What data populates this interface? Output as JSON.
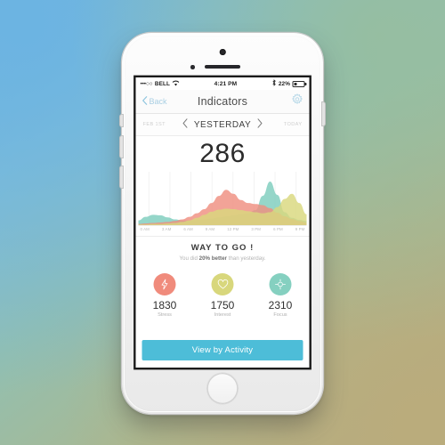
{
  "background": {
    "gradient_from": "#6FB4E0",
    "gradient_mid": "#93BFAF",
    "gradient_to": "#B7A97E"
  },
  "status_bar": {
    "signal_dots": "•••○○",
    "carrier": "BELL",
    "wifi_icon": "wifi-icon",
    "time": "4:21 PM",
    "bluetooth_icon": "bluetooth-icon",
    "battery_percent": "22%",
    "battery_icon": "battery-icon"
  },
  "nav_bar": {
    "back_label": "Back",
    "back_icon": "chevron-left-icon",
    "title": "Indicators",
    "settings_icon": "gear-icon"
  },
  "date_bar": {
    "left_label": "FEB 1ST",
    "prev_icon": "chevron-left-icon",
    "current_label": "YESTERDAY",
    "next_icon": "chevron-right-icon",
    "right_label": "TODAY"
  },
  "score": {
    "value": "286"
  },
  "chart_data": {
    "type": "area",
    "title": "",
    "xlabel": "",
    "ylabel": "",
    "grid": true,
    "legend_position": "none",
    "stacked": false,
    "x": [
      "0 AM",
      "1 AM",
      "2 AM",
      "3 AM",
      "4 AM",
      "5 AM",
      "6 AM",
      "7 AM",
      "8 AM",
      "9 AM",
      "10 AM",
      "11 AM",
      "12 PM",
      "1 PM",
      "2 PM",
      "3 PM",
      "4 PM",
      "5 PM",
      "6 PM",
      "7 PM",
      "8 PM",
      "9 PM",
      "10 PM",
      "11 PM"
    ],
    "tick_labels": [
      "0 AM",
      "3 AM",
      "6 AM",
      "9 AM",
      "12 PM",
      "3 PM",
      "6 PM",
      "9 PM"
    ],
    "ylim": [
      0,
      100
    ],
    "series": [
      {
        "name": "Focus",
        "color": "#7ecdbd",
        "values": [
          10,
          17,
          21,
          20,
          16,
          12,
          10,
          10,
          11,
          12,
          14,
          16,
          18,
          20,
          22,
          24,
          30,
          58,
          86,
          60,
          26,
          15,
          11,
          9
        ]
      },
      {
        "name": "Stress",
        "color": "#ef8f80",
        "values": [
          3,
          4,
          5,
          6,
          7,
          9,
          12,
          17,
          24,
          32,
          44,
          58,
          70,
          62,
          50,
          44,
          42,
          40,
          34,
          25,
          18,
          13,
          9,
          6
        ]
      },
      {
        "name": "Interest",
        "color": "#d9d87e",
        "values": [
          2,
          2,
          3,
          3,
          4,
          5,
          7,
          10,
          15,
          21,
          27,
          31,
          33,
          32,
          30,
          28,
          26,
          24,
          26,
          36,
          52,
          62,
          44,
          22
        ]
      }
    ]
  },
  "message": {
    "title": "WAY  TO GO !",
    "prefix": "You did ",
    "highlight": "20% better",
    "suffix": " than yesterday."
  },
  "metrics": [
    {
      "icon": "lightning-bolt-icon",
      "color": "#f08b7c",
      "value": "1830",
      "label": "Stress"
    },
    {
      "icon": "heart-icon",
      "color": "#d8d77c",
      "value": "1750",
      "label": "Interest"
    },
    {
      "icon": "crosshair-icon",
      "color": "#85d0c0",
      "value": "2310",
      "label": "Focus"
    }
  ],
  "cta": {
    "label": "View by Activity",
    "color": "#4dbdd8"
  }
}
